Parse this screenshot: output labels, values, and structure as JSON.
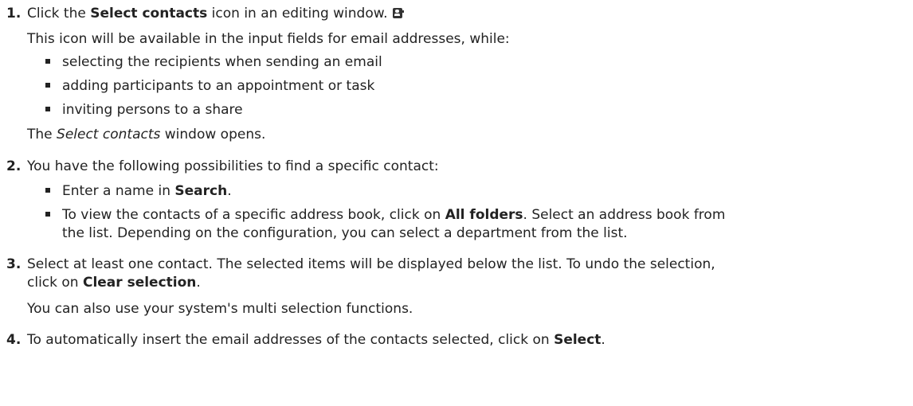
{
  "steps": [
    {
      "number": "1.",
      "line_prefix": "Click the ",
      "line_bold": "Select contacts",
      "line_suffix": " icon in an editing window.",
      "icon": "contact-card-icon",
      "note": "This icon will be available in the input fields for email addresses, while:",
      "bullets": [
        "selecting the recipients when sending an email",
        "adding participants to an appointment or task",
        "inviting persons to a share"
      ],
      "result_prefix": "The ",
      "result_italic": "Select contacts",
      "result_suffix": " window opens."
    },
    {
      "number": "2.",
      "line": "You have the following possibilities to find a specific contact:",
      "bullet1_prefix": "Enter a name in ",
      "bullet1_bold": "Search",
      "bullet1_suffix": ".",
      "bullet2_prefix": "To view the contacts of a specific address book, click on ",
      "bullet2_bold": "All folders",
      "bullet2_suffix": ". Select an address book from",
      "bullet2_line2": "the list. Depending on the configuration, you can select a department from the list."
    },
    {
      "number": "3.",
      "line1": "Select at least one contact. The selected items will be displayed below the list. To undo the selection,",
      "line2_prefix": "click on ",
      "line2_bold": "Clear selection",
      "line2_suffix": ".",
      "note": "You can also use your system's multi selection functions."
    },
    {
      "number": "4.",
      "line_prefix": "To automatically insert the email addresses of the contacts selected, click on ",
      "line_bold": "Select",
      "line_suffix": "."
    }
  ]
}
